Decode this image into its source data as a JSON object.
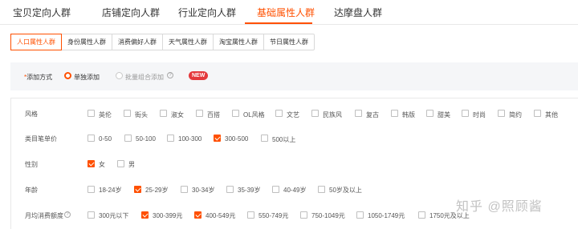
{
  "top_tabs": [
    "宝贝定向人群",
    "店铺定向人群",
    "行业定向人群",
    "基础属性人群",
    "达摩盘人群"
  ],
  "top_tabs_active": "基础属性人群",
  "sub_tabs": [
    "人口属性人群",
    "身份属性人群",
    "消费偏好人群",
    "天气属性人群",
    "淘宝属性人群",
    "节日属性人群"
  ],
  "sub_tabs_active": "人口属性人群",
  "method": {
    "required_mark": "*",
    "label": "添加方式",
    "option_single": "单独添加",
    "option_batch": "批量组合添加",
    "help": "?",
    "badge": "NEW"
  },
  "rows": {
    "style": {
      "label": "风格",
      "options": [
        "英伦",
        "街头",
        "淑女",
        "百搭",
        "OL风格",
        "文艺",
        "民族风",
        "复古",
        "韩版",
        "甜美",
        "时尚",
        "简约",
        "其他"
      ]
    },
    "price": {
      "label": "类目笔单价",
      "options": [
        "0-50",
        "50-100",
        "100-300",
        "300-500",
        "500以上"
      ]
    },
    "gender": {
      "label": "性别",
      "options": [
        "女",
        "男"
      ]
    },
    "age": {
      "label": "年龄",
      "options": [
        "18-24岁",
        "25-29岁",
        "30-34岁",
        "35-39岁",
        "40-49岁",
        "50岁及以上"
      ]
    },
    "spend": {
      "label": "月均消费额度",
      "options": [
        "300元以下",
        "300-399元",
        "400-549元",
        "550-749元",
        "750-1049元",
        "1050-1749元",
        "1750元及以上"
      ]
    }
  },
  "checked": {
    "price": [
      "300-500"
    ],
    "gender": [
      "女"
    ],
    "age": [
      "25-29岁"
    ],
    "spend": [
      "300-399元",
      "400-549元"
    ]
  },
  "watermark": "知乎 @照顾酱",
  "colors": {
    "accent": "#ff5000",
    "badge": "#e4393c"
  }
}
